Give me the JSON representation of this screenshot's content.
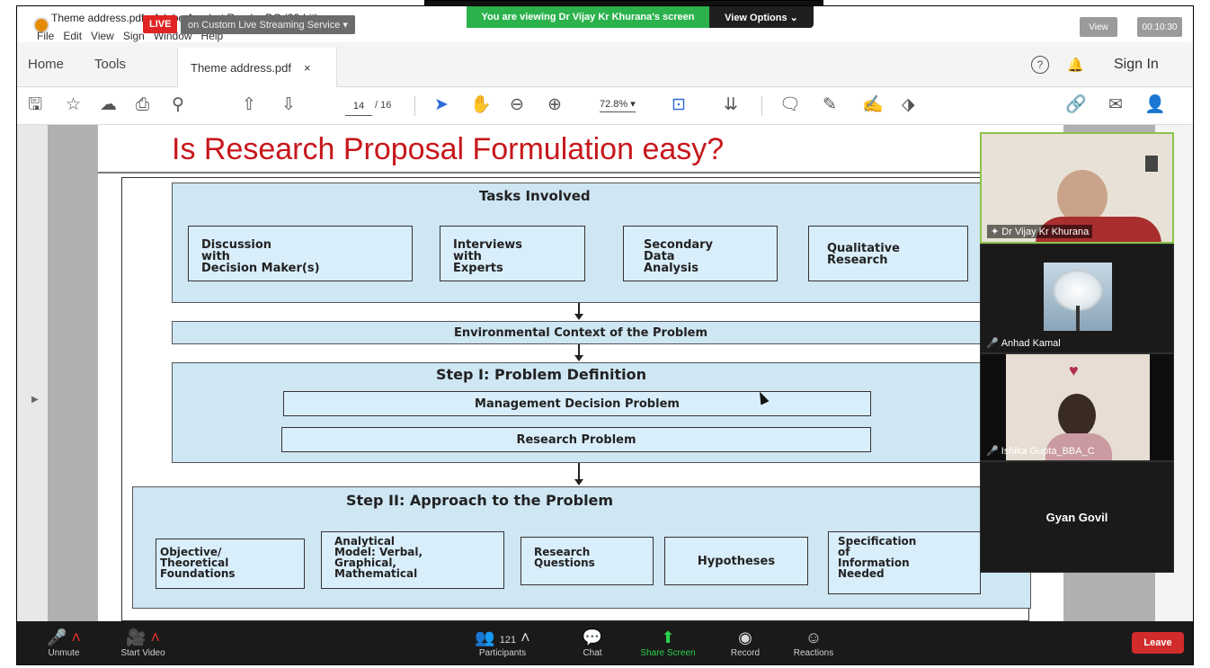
{
  "meeting": {
    "live_badge": "LIVE",
    "stream_label": "on Custom Live Streaming Service ▾",
    "viewing_banner": "You are viewing Dr Vijay Kr Khurana's screen",
    "view_options": "View Options ⌄",
    "view_chip": "View",
    "elapsed_time": "00:10:30"
  },
  "acrobat": {
    "window_title": "Theme address.pdf - Adobe Acrobat Reader DC (32-bit)",
    "menu": [
      "File",
      "Edit",
      "View",
      "Sign",
      "Window",
      "Help"
    ],
    "tabs": {
      "home": "Home",
      "tools": "Tools",
      "document": "Theme address.pdf",
      "close_glyph": "×"
    },
    "help_glyph": "?",
    "sign_in": "Sign In",
    "page_current": "14",
    "page_total": "/ 16",
    "zoom": "72.8%  ▾"
  },
  "slide": {
    "title": "Is Research Proposal Formulation easy?",
    "tasks_header": "Tasks Involved",
    "tasks": [
      "Discussion\nwith\nDecision Maker(s)",
      "Interviews\nwith\nExperts",
      "Secondary\nData\nAnalysis",
      "Qualitative\nResearch"
    ],
    "environmental_context": "Environmental Context of the Problem",
    "step1_header": "Step I: Problem Definition",
    "management_problem": "Management Decision Problem",
    "research_problem": "Research Problem",
    "step2_header": "Step II:  Approach to the Problem",
    "approach_items": [
      "Objective/\nTheoretical\nFoundations",
      "Analytical\nModel: Verbal,\nGraphical,\nMathematical",
      "Research\nQuestions",
      "Hypotheses",
      "Specification\nof\nInformation\nNeeded"
    ]
  },
  "participants_tiles": [
    {
      "name": "Dr Vijay Kr Khurana",
      "role": "host"
    },
    {
      "name": "Anhad Kamal",
      "muted": true
    },
    {
      "name": "Ishika Gupta_BBA_C",
      "muted": true
    },
    {
      "name": "Gyan Govil"
    }
  ],
  "zoom_bar": {
    "unmute": "Unmute",
    "start_video": "Start Video",
    "participants": "Participants",
    "participants_count": "121",
    "chat": "Chat",
    "share_screen": "Share Screen",
    "record": "Record",
    "reactions": "Reactions",
    "leave": "Leave"
  }
}
